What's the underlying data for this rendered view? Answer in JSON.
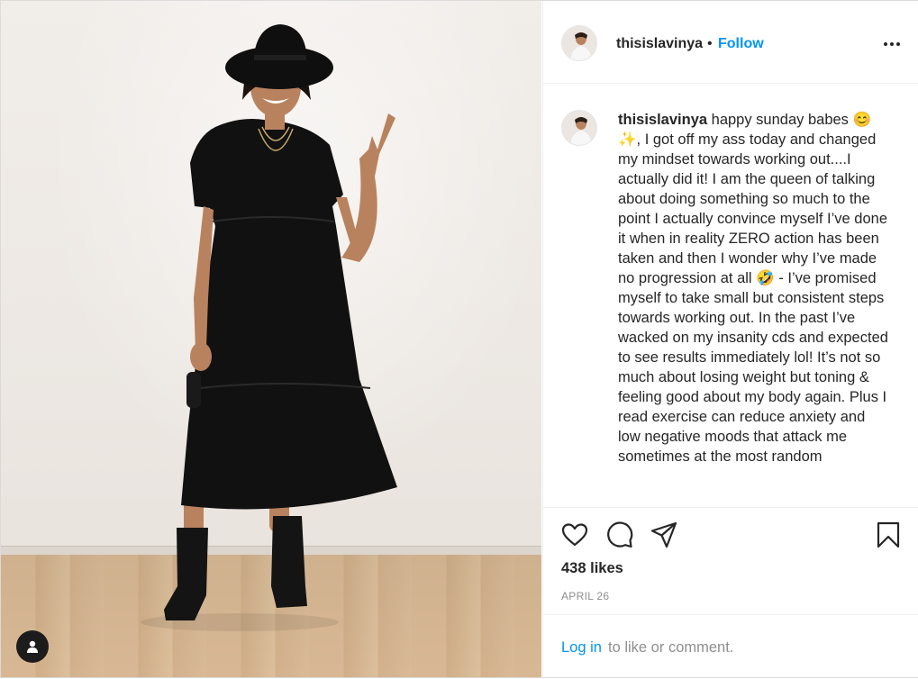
{
  "post": {
    "username": "thisislavinya",
    "separator": "•",
    "follow_label": "Follow",
    "caption_text": " happy sunday babes 😊 ✨, I got off my ass today and changed my mindset towards working out....I actually did it! I am the queen of talking about doing something so much to the point I actually convince myself I’ve done it when in reality ZERO action has been taken and then I wonder why I’ve made no progression at all 🤣 - I’ve promised myself to take small but consistent steps towards working out. In the past I’ve wacked on my insanity cds and expected to see results immediately lol! It’s not so much about losing weight but toning & feeling good about my body again. Plus I read exercise can reduce anxiety and low negative moods that attack me sometimes at the most random",
    "likes": "438 likes",
    "date": "APRIL 26",
    "login_link": "Log in",
    "login_rest": " to like or comment."
  },
  "icons": {
    "more": "more-options-icon",
    "like": "heart-icon",
    "comment": "comment-icon",
    "share": "share-icon",
    "save": "bookmark-icon",
    "user": "user-icon"
  },
  "colors": {
    "link": "#0095f6",
    "text": "#262626",
    "muted": "#8e8e8e",
    "border": "#efefef"
  }
}
